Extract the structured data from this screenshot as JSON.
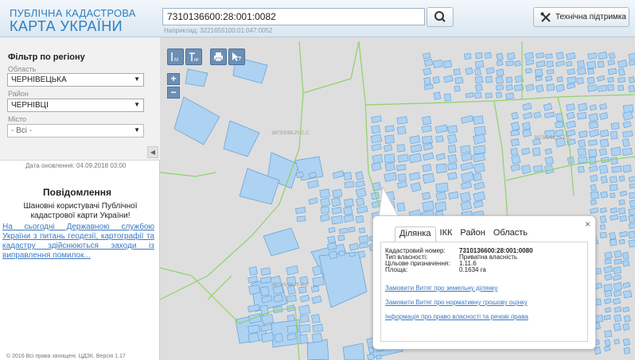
{
  "header": {
    "logo_line1": "ПУБЛІЧНА КАДАСТРОВА",
    "logo_line2": "КАРТА УКРАЇНИ",
    "search_value": "7310136600:28:001:0082",
    "search_hint": "Наприклад: 3221655100:01:047:0052",
    "support_label": "Технічна підтримка"
  },
  "filter": {
    "title": "Фільтр по регіону",
    "oblast_label": "Область",
    "oblast_value": "ЧЕРНІВЕЦЬКА",
    "raion_label": "Район",
    "raion_value": "ЧЕРНІВЦІ",
    "misto_label": "Місто",
    "misto_value": "- Всі -"
  },
  "sidebar": {
    "update_date": "Дата оновлення: 04.09.2018 03:00",
    "notice_title": "Повідомлення",
    "notice_text": "Шановні користувачі Публічної кадастрової карти України!",
    "notice_link": "На сьогодні Державною службою України з питань геодезії, картографії та кадастру здійснюються заходи із виправлення помилок...",
    "footer": "© 2016 Всі права захищені. ЦДЗК. Версія 1.17"
  },
  "map": {
    "tools": [
      "measure-length",
      "measure-area",
      "print",
      "identify"
    ],
    "zoom_in": "+",
    "zoom_out": "−",
    "map_label": "3873/5/98.25 С.С"
  },
  "popup": {
    "close": "×",
    "tabs": [
      "Ділянка",
      "ІКК",
      "Район",
      "Область"
    ],
    "active_tab": "Ділянка",
    "fields": [
      {
        "label": "Кадастровий номер:",
        "value": "7310136600:28:001:0080"
      },
      {
        "label": "Тип власності:",
        "value": "Приватна власність"
      },
      {
        "label": "Цільове призначення:",
        "value": "1.11.6"
      },
      {
        "label": "Площа:",
        "value": "0.1634 га"
      }
    ],
    "links": [
      "Замовити Витяг про земельну ділянку",
      "Замовити Витяг про нормативну грошову оцінку",
      "Інформація про право власності та речові права"
    ]
  },
  "colors": {
    "parcel_fill": "#aed2f1",
    "parcel_stroke": "#5f9ed6",
    "boundary": "#8fd16b",
    "tool_bg": "#6b8fb5",
    "link": "#3a78c2",
    "logo": "#2f7fc0"
  }
}
